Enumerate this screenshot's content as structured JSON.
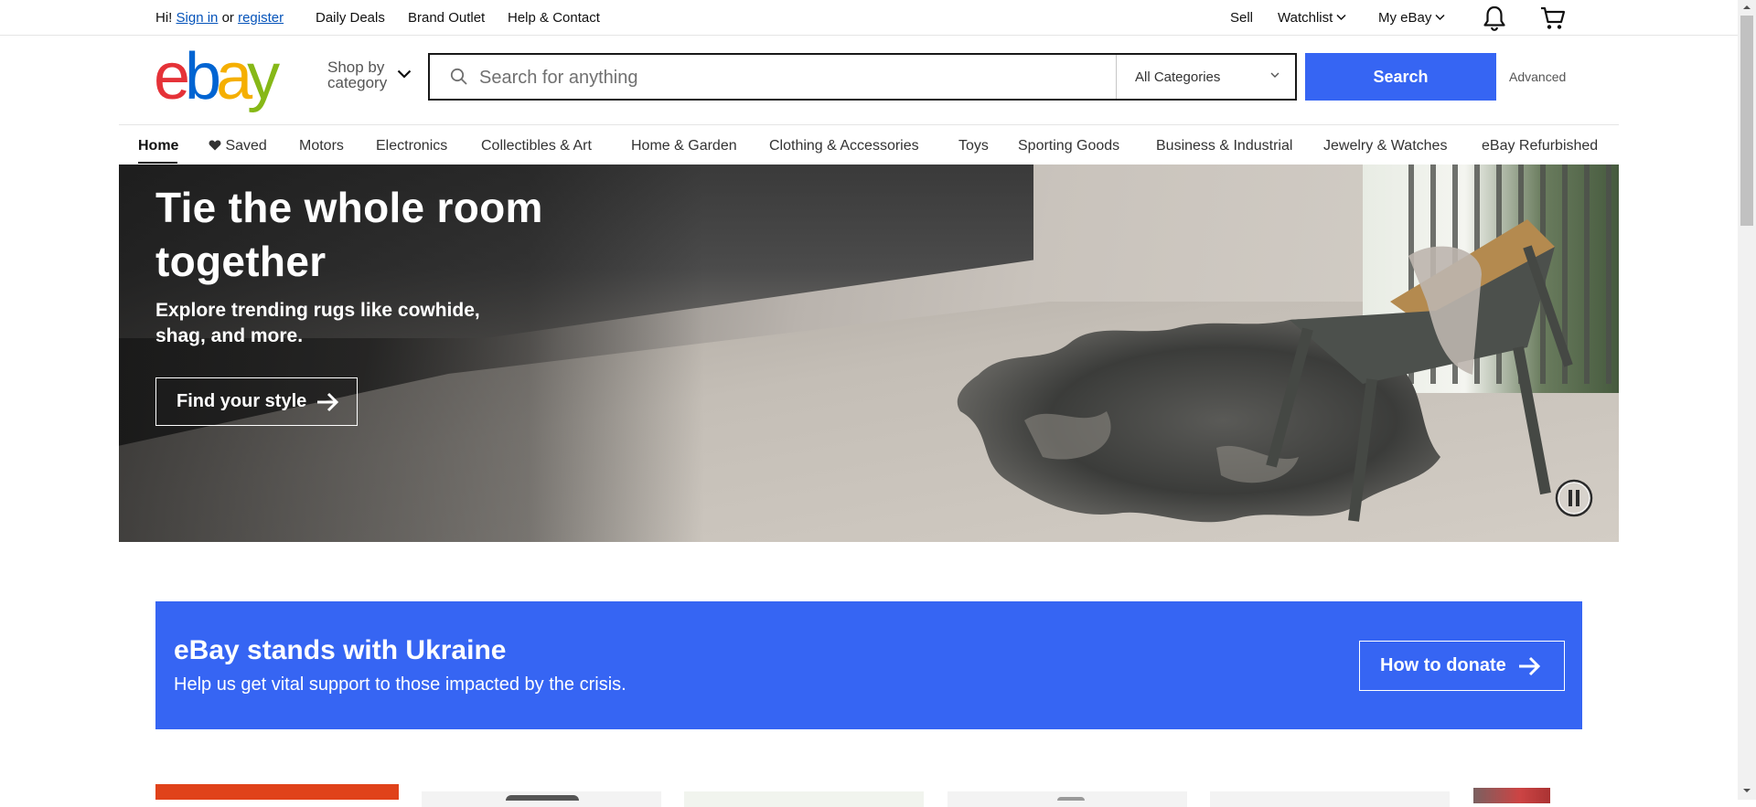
{
  "topbar": {
    "greeting": "Hi!",
    "sign_in": "Sign in",
    "or": "or",
    "register": "register",
    "daily_deals": "Daily Deals",
    "brand_outlet": "Brand Outlet",
    "help_contact": "Help & Contact",
    "sell": "Sell",
    "watchlist": "Watchlist",
    "my_ebay": "My eBay"
  },
  "header": {
    "logo": [
      "e",
      "b",
      "a",
      "y"
    ],
    "logo_colors": [
      "#e53238",
      "#0064d2",
      "#f5af02",
      "#86b817"
    ],
    "shop_by_line1": "Shop by",
    "shop_by_line2": "category",
    "search_placeholder": "Search for anything",
    "category_selected": "All Categories",
    "search_button": "Search",
    "advanced": "Advanced"
  },
  "nav": {
    "items": [
      "Home",
      "Saved",
      "Motors",
      "Electronics",
      "Collectibles & Art",
      "Home & Garden",
      "Clothing & Accessories",
      "Toys",
      "Sporting Goods",
      "Business & Industrial",
      "Jewelry & Watches",
      "eBay Refurbished"
    ]
  },
  "hero": {
    "title": "Tie the whole room together",
    "subtitle": "Explore trending rugs like cowhide, shag, and more.",
    "cta": "Find your style"
  },
  "ukraine": {
    "title": "eBay stands with Ukraine",
    "subtitle": "Help us get vital support to those impacted by the crisis.",
    "cta": "How to donate"
  },
  "colors": {
    "accent": "#3665f3",
    "link": "#0654ba"
  }
}
